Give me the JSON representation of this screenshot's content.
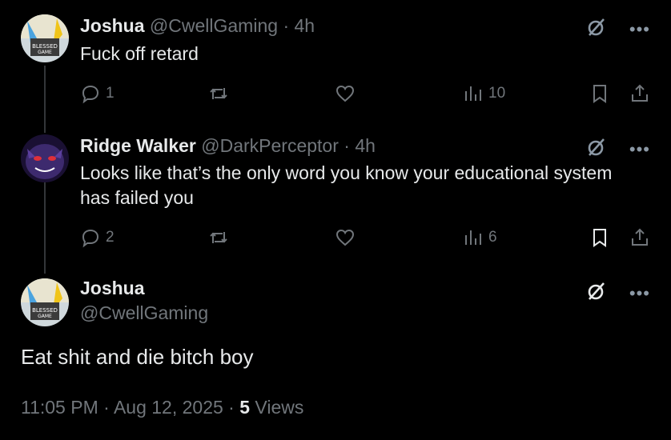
{
  "tweets": [
    {
      "name": "Joshua",
      "handle": "@CwellGaming",
      "sep": "·",
      "time": "4h",
      "text": "Fuck off retard",
      "replies": "1",
      "reposts": "",
      "likes": "",
      "views": "10"
    },
    {
      "name": "Ridge Walker",
      "handle": "@DarkPerceptor",
      "sep": "·",
      "time": "4h",
      "text_line1": "Looks like that’s the only word you know your educational system",
      "text_line2": "has failed you",
      "replies": "2",
      "reposts": "",
      "likes": "",
      "views": "6"
    }
  ],
  "main": {
    "name": "Joshua",
    "handle": "@CwellGaming",
    "text": "Eat shit and die bitch boy",
    "time": "11:05 PM",
    "sep1": "·",
    "date": "Aug 12, 2025",
    "sep2": "·",
    "views_count": "5",
    "views_label": "Views"
  },
  "icons": {
    "more": "•••",
    "grok": "grok-icon",
    "reply": "reply-icon",
    "repost": "repost-icon",
    "like": "like-icon",
    "views": "views-icon",
    "bookmark": "bookmark-icon",
    "share": "share-icon"
  },
  "colors": {
    "background": "#000000",
    "text": "#e7e9ea",
    "muted": "#71767b",
    "thread_line": "#333639"
  }
}
